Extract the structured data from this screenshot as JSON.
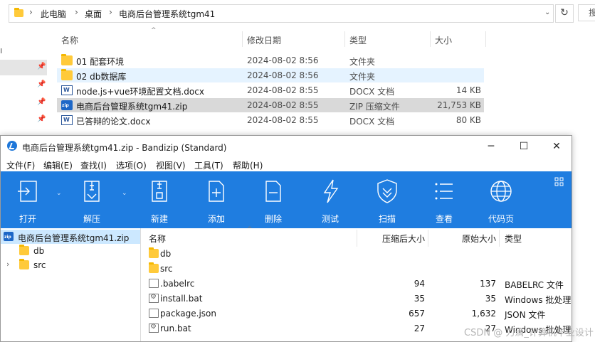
{
  "explorer": {
    "breadcrumb": [
      "此电脑",
      "桌面",
      "电商后台管理系统tgm41"
    ],
    "search_partial": "搜",
    "columns": {
      "name": "名称",
      "modified": "修改日期",
      "type": "类型",
      "size": "大小"
    },
    "files": [
      {
        "name": "01  配套环境",
        "modified": "2024-08-02 8:56",
        "type": "文件夹",
        "size": "",
        "icon": "folder-icon"
      },
      {
        "name": "02 db数据库",
        "modified": "2024-08-02 8:56",
        "type": "文件夹",
        "size": "",
        "icon": "folder-icon"
      },
      {
        "name": "node.js+vue环境配置文档.docx",
        "modified": "2024-08-02 8:55",
        "type": "DOCX 文档",
        "size": "14 KB",
        "icon": "word-doc-icon"
      },
      {
        "name": "电商后台管理系统tgm41.zip",
        "modified": "2024-08-02 8:55",
        "type": "ZIP 压缩文件",
        "size": "21,753 KB",
        "icon": "zip-file-icon"
      },
      {
        "name": "已答辩的论文.docx",
        "modified": "2024-08-02 8:55",
        "type": "DOCX 文档",
        "size": "80 KB",
        "icon": "word-doc-icon"
      }
    ]
  },
  "bandizip": {
    "title": "电商后台管理系统tgm41.zip - Bandizip (Standard)",
    "menu": [
      "文件(F)",
      "编辑(E)",
      "查找(I)",
      "选项(O)",
      "视图(V)",
      "工具(T)",
      "帮助(H)"
    ],
    "toolbar": [
      "打开",
      "解压",
      "新建",
      "添加",
      "删除",
      "测试",
      "扫描",
      "查看",
      "代码页"
    ],
    "tree": {
      "root": "电商后台管理系统tgm41.zip",
      "children": [
        "db",
        "src"
      ]
    },
    "list_columns": {
      "name": "名称",
      "packed": "压缩后大小",
      "original": "原始大小",
      "type": "类型"
    },
    "list": [
      {
        "name": "db",
        "packed": "",
        "original": "",
        "type": ""
      },
      {
        "name": "src",
        "packed": "",
        "original": "",
        "type": ""
      },
      {
        "name": ".babelrc",
        "packed": "94",
        "original": "137",
        "type": "BABELRC 文件"
      },
      {
        "name": "install.bat",
        "packed": "35",
        "original": "35",
        "type": "Windows 批处理"
      },
      {
        "name": "package.json",
        "packed": "657",
        "original": "1,632",
        "type": "JSON 文件"
      },
      {
        "name": "run.bat",
        "packed": "27",
        "original": "27",
        "type": "Windows 批处理"
      }
    ]
  },
  "watermark": "CSDN @ 刀滴_计算机毕业设计"
}
